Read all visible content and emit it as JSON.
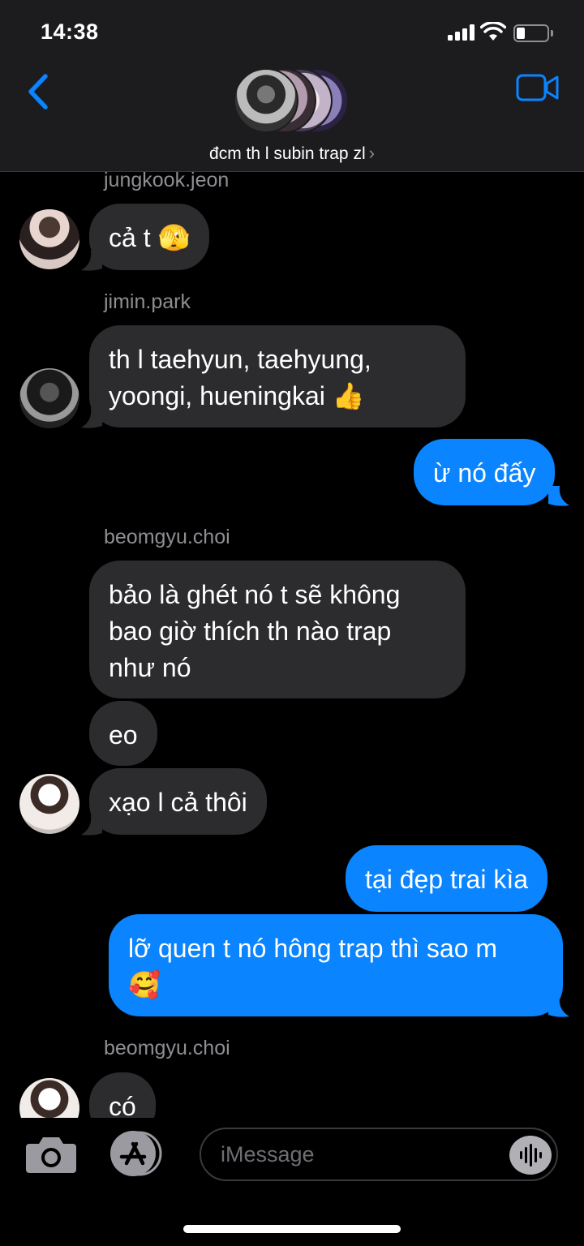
{
  "status_bar": {
    "time": "14:38"
  },
  "header": {
    "group_name": "đcm th l subin trap zl",
    "chevron_glyph": "›"
  },
  "composer": {
    "placeholder": "iMessage"
  },
  "messages": [
    {
      "sender": "jungkook.jeon"
    },
    {
      "text": "cả t 🫣"
    },
    {
      "sender": "jimin.park"
    },
    {
      "text_line1": "th l taehyun, taehyung,",
      "text_line2": "yoongi, hueningkai 👍"
    },
    {
      "text": "ừ nó đấy"
    },
    {
      "sender": "beomgyu.choi"
    },
    {
      "text_line1": "bảo là ghét nó t sẽ không",
      "text_line2": "bao giờ thích th nào trap",
      "text_line3": "như nó"
    },
    {
      "text": "eo"
    },
    {
      "text": "xạo l cả thôi"
    },
    {
      "text": "tại đẹp trai kìa"
    },
    {
      "text_line1": "lỡ quen t nó hông trap thì sao m",
      "text_line2": "🥰"
    },
    {
      "sender": "beomgyu.choi"
    },
    {
      "text": "có"
    }
  ],
  "colors": {
    "outgoing": "#0a84ff",
    "incoming": "#2c2c2e",
    "accent": "#0a84ff"
  },
  "icons": [
    "back-chevron-icon",
    "video-camera-icon",
    "camera-icon",
    "app-store-icon",
    "audio-waveform-icon"
  ]
}
